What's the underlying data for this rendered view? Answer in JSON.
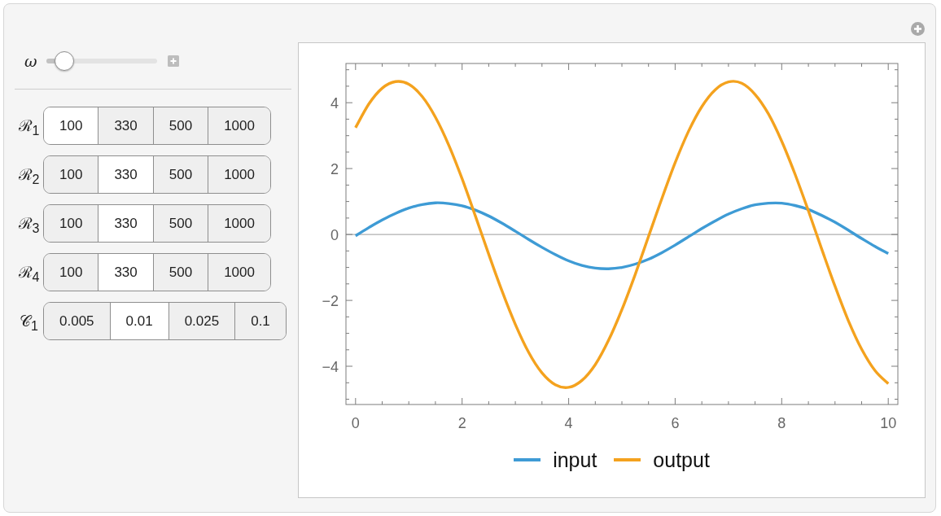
{
  "controls": {
    "omega_slider": {
      "label": "ω",
      "level": 0.09
    },
    "setter_bars": [
      {
        "label": "ℛ$_{1}$",
        "options": [
          {
            "label": "100",
            "selected": true
          },
          {
            "label": "330",
            "selected": false
          },
          {
            "label": "500",
            "selected": false
          },
          {
            "label": "1000",
            "selected": false
          }
        ]
      },
      {
        "label": "ℛ$_{2}$",
        "options": [
          {
            "label": "100",
            "selected": false
          },
          {
            "label": "330",
            "selected": true
          },
          {
            "label": "500",
            "selected": false
          },
          {
            "label": "1000",
            "selected": false
          }
        ]
      },
      {
        "label": "ℛ$_{3}$",
        "options": [
          {
            "label": "100",
            "selected": false
          },
          {
            "label": "330",
            "selected": true
          },
          {
            "label": "500",
            "selected": false
          },
          {
            "label": "1000",
            "selected": false
          }
        ]
      },
      {
        "label": "ℛ$_{4}$",
        "options": [
          {
            "label": "100",
            "selected": false
          },
          {
            "label": "330",
            "selected": true
          },
          {
            "label": "500",
            "selected": false
          },
          {
            "label": "1000",
            "selected": false
          }
        ]
      },
      {
        "label": "𝒞$_{1}$",
        "options": [
          {
            "label": "0.005",
            "selected": false
          },
          {
            "label": "0.01",
            "selected": true
          },
          {
            "label": "0.025",
            "selected": false
          },
          {
            "label": "0.1",
            "selected": false
          }
        ]
      }
    ]
  },
  "plot": {
    "chart_data": {
      "type": "line",
      "x": [
        0,
        0.25,
        0.5,
        0.75,
        1,
        1.25,
        1.5,
        1.75,
        2,
        2.25,
        2.5,
        2.75,
        3,
        3.25,
        3.5,
        3.75,
        4,
        4.25,
        4.5,
        4.75,
        5,
        5.25,
        5.5,
        5.75,
        6,
        6.25,
        6.5,
        6.75,
        7,
        7.25,
        7.5,
        7.75,
        8,
        8.25,
        8.5,
        8.75,
        9,
        9.25,
        9.5,
        9.75,
        10
      ],
      "series": [
        {
          "name": "input",
          "color": "#3e9bd5",
          "values": [
            -0.04,
            0.21,
            0.44,
            0.64,
            0.8,
            0.91,
            0.96,
            0.94,
            0.87,
            0.74,
            0.56,
            0.34,
            0.1,
            -0.15,
            -0.39,
            -0.61,
            -0.8,
            -0.94,
            -1.02,
            -1.04,
            -1.0,
            -0.9,
            -0.75,
            -0.55,
            -0.32,
            -0.07,
            0.18,
            0.41,
            0.62,
            0.78,
            0.9,
            0.95,
            0.95,
            0.88,
            0.76,
            0.58,
            0.37,
            0.13,
            -0.12,
            -0.36,
            -0.58
          ]
        },
        {
          "name": "output",
          "color": "#f4a21e",
          "values": [
            3.24,
            3.96,
            4.44,
            4.64,
            4.56,
            4.19,
            3.56,
            2.71,
            1.69,
            0.56,
            -0.6,
            -1.72,
            -2.73,
            -3.58,
            -4.2,
            -4.56,
            -4.64,
            -4.43,
            -3.95,
            -3.21,
            -2.28,
            -1.21,
            -0.06,
            1.09,
            2.18,
            3.13,
            3.88,
            4.39,
            4.63,
            4.59,
            4.25,
            3.66,
            2.83,
            1.83,
            0.72,
            -0.44,
            -1.57,
            -2.61,
            -3.48,
            -4.13,
            -4.53
          ]
        }
      ],
      "xlim": [
        -0.18,
        10.18
      ],
      "ylim": [
        -5.16,
        5.19
      ],
      "xticks": [
        0,
        2,
        4,
        6,
        8,
        10
      ],
      "yticks": [
        {
          "value": -4,
          "label": "−4"
        },
        {
          "value": -2,
          "label": "−2"
        },
        0,
        2,
        4
      ],
      "legend": "bottom"
    }
  }
}
